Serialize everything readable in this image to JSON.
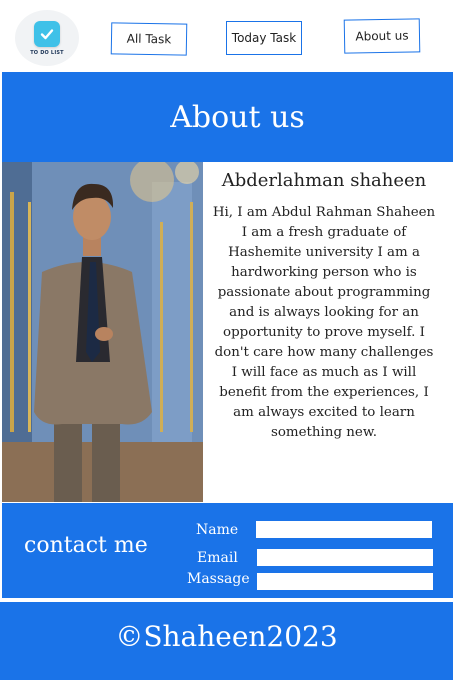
{
  "logo": {
    "text": "TO DO LIST"
  },
  "nav": {
    "all_task": "All Task",
    "today_task": "Today Task",
    "about_us": "About us"
  },
  "banner": {
    "title": "About us"
  },
  "bio": {
    "name": "Abderlahman shaheen",
    "text": "Hi, I am Abdul Rahman Shaheen I am a fresh graduate of Hashemite university I am a hardworking person who is passionate about programming and is always looking for an opportunity to prove myself. I don't care how many challenges I will face as much as I will benefit from the experiences, I am always excited to learn something new."
  },
  "contact": {
    "title": "contact me",
    "name_label": "Name",
    "email_label": "Email",
    "message_label": "Massage"
  },
  "footer": {
    "text": "©Shaheen2023"
  },
  "colors": {
    "primary": "#1a73e8",
    "logo_badge": "#3fc1e8"
  }
}
